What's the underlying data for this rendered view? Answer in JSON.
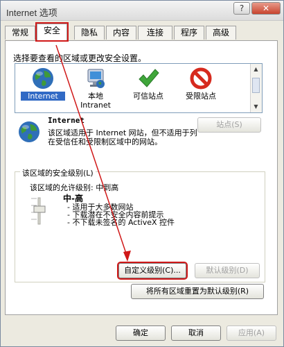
{
  "window": {
    "title": "Internet 选项",
    "help_label": "?",
    "close_label": "✕"
  },
  "tabs": [
    "常规",
    "安全",
    "隐私",
    "内容",
    "连接",
    "程序",
    "高级"
  ],
  "security": {
    "intro": "选择要查看的区域或更改安全设置。",
    "zones": [
      {
        "name": "Internet",
        "icon": "globe-icon",
        "selected": true
      },
      {
        "name": "本地 Intranet",
        "icon": "intranet-monitor-icon",
        "selected": false
      },
      {
        "name": "可信站点",
        "icon": "checkmark-icon",
        "selected": false
      },
      {
        "name": "受限站点",
        "icon": "prohibited-icon",
        "selected": false
      }
    ],
    "zone_label_line1": "本地",
    "zone_label_line2": "Intranet",
    "selected_zone": {
      "name": "Internet",
      "description": "该区域适用于 Internet 网站，但不适用于列在受信任和受限制区域中的网站。"
    },
    "sites_button": "站点(S)",
    "group_title": "该区域的安全级别(L)",
    "allowed_levels": "该区域的允许级别: 中到高",
    "level_name": "中-高",
    "level_bullets": [
      "- 适用于大多数网站",
      "- 下载潜在不安全内容前提示",
      "- 不下载未签名的 ActiveX 控件"
    ],
    "custom_level_button": "自定义级别(C)...",
    "default_level_button": "默认级别(D)",
    "reset_all_button": "将所有区域重置为默认级别(R)"
  },
  "dialog_buttons": {
    "ok": "确定",
    "cancel": "取消",
    "apply": "应用(A)"
  },
  "colors": {
    "highlight_red": "#d01818",
    "selection_blue": "#316ac5"
  }
}
